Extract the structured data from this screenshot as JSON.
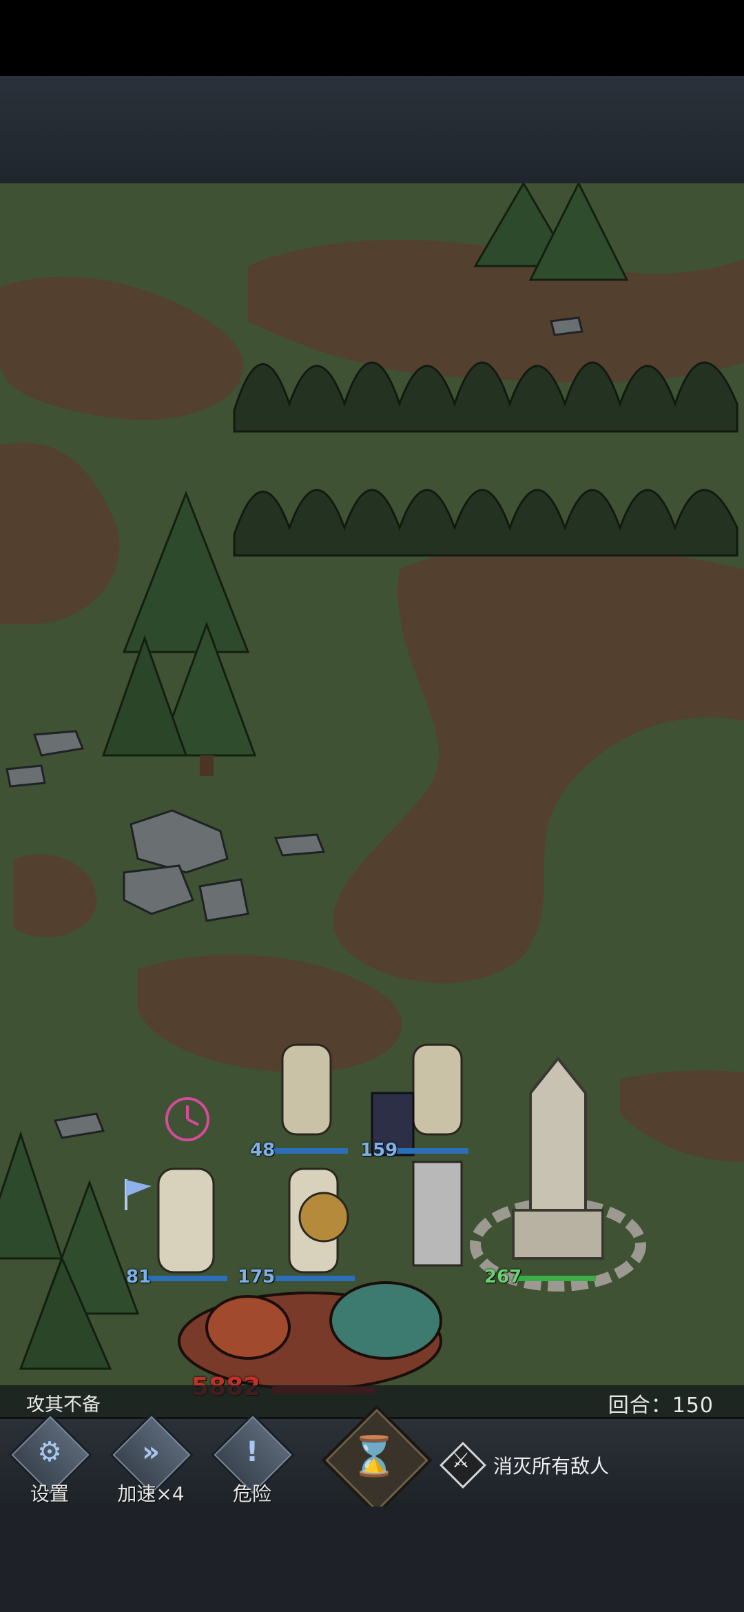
{
  "battle": {
    "ambush_label": "攻其不备",
    "turn_label": "回合：150"
  },
  "units": {
    "hp_a": "48",
    "hp_b": "159",
    "hp_c": "81",
    "hp_d": "175",
    "hp_e": "267",
    "hp_boss": "5882"
  },
  "toolbar": {
    "settings_label": "设置",
    "speed_label": "加速×4",
    "danger_label": "危险",
    "settings_icon": "gear-icon",
    "speed_icon": "fast-forward-icon",
    "danger_icon": "exclamation-icon",
    "end_turn_icon": "hourglass-icon"
  },
  "objective": {
    "text": "消灭所有敌人",
    "icon": "crossed-swords-icon"
  },
  "colors": {
    "grass": "#3f5234",
    "dirt": "#54402f",
    "panel": "#2b3138",
    "player_hp": "#7fb0e8",
    "ally_hp": "#6ad070",
    "enemy_hp": "#c23028"
  }
}
